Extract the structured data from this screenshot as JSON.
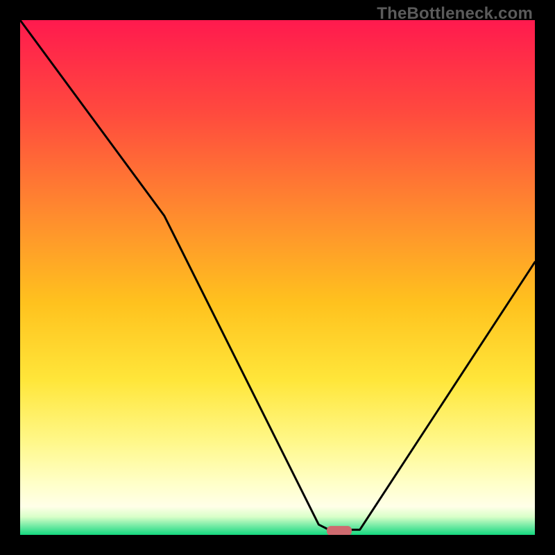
{
  "watermark": "TheBottleneck.com",
  "chart_data": {
    "type": "line",
    "title": "",
    "xlabel": "",
    "ylabel": "",
    "xlim": [
      0,
      100
    ],
    "ylim": [
      0,
      100
    ],
    "x_optimum": 62,
    "curve": [
      {
        "x": 0,
        "y": 100
      },
      {
        "x": 28,
        "y": 62
      },
      {
        "x": 58,
        "y": 2
      },
      {
        "x": 60,
        "y": 1
      },
      {
        "x": 66,
        "y": 1
      },
      {
        "x": 100,
        "y": 53
      }
    ],
    "marker": {
      "x": 62,
      "y": 0.8,
      "color": "#cf6a6f"
    },
    "gradient_stops": [
      {
        "offset": 0.0,
        "color": "#ff1a4e"
      },
      {
        "offset": 0.18,
        "color": "#ff4a3e"
      },
      {
        "offset": 0.38,
        "color": "#ff8c2e"
      },
      {
        "offset": 0.55,
        "color": "#ffc21e"
      },
      {
        "offset": 0.7,
        "color": "#ffe63a"
      },
      {
        "offset": 0.82,
        "color": "#fff88a"
      },
      {
        "offset": 0.9,
        "color": "#ffffc8"
      },
      {
        "offset": 0.945,
        "color": "#ffffe8"
      },
      {
        "offset": 0.965,
        "color": "#d8ffc8"
      },
      {
        "offset": 0.985,
        "color": "#66e8a0"
      },
      {
        "offset": 1.0,
        "color": "#14d87e"
      }
    ]
  }
}
